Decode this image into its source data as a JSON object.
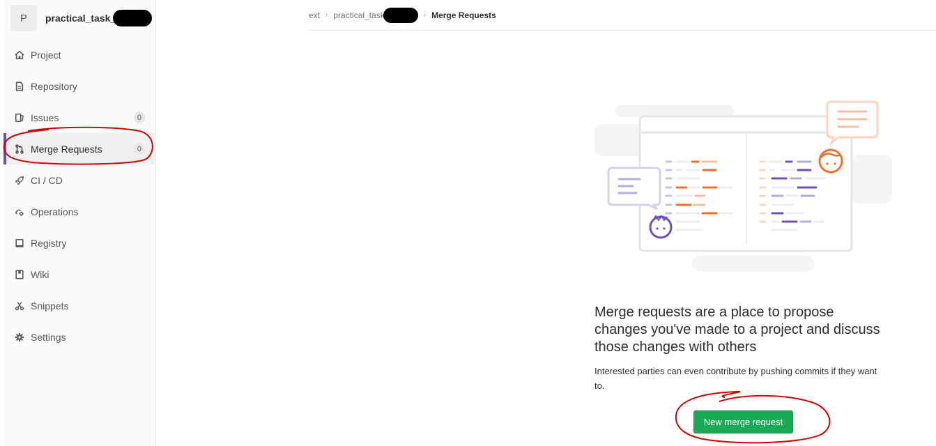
{
  "sidebar": {
    "project_avatar_letter": "P",
    "project_name": "practical_task_",
    "items": [
      {
        "label": "Project",
        "icon": "home-icon",
        "count": null
      },
      {
        "label": "Repository",
        "icon": "document-icon",
        "count": null
      },
      {
        "label": "Issues",
        "icon": "issues-icon",
        "count": "0"
      },
      {
        "label": "Merge Requests",
        "icon": "merge-request-icon",
        "count": "0",
        "active": true
      },
      {
        "label": "CI / CD",
        "icon": "rocket-icon",
        "count": null
      },
      {
        "label": "Operations",
        "icon": "cloud-gear-icon",
        "count": null
      },
      {
        "label": "Registry",
        "icon": "disk-icon",
        "count": null
      },
      {
        "label": "Wiki",
        "icon": "book-icon",
        "count": null
      },
      {
        "label": "Snippets",
        "icon": "scissors-icon",
        "count": null
      },
      {
        "label": "Settings",
        "icon": "gear-icon",
        "count": null
      }
    ]
  },
  "breadcrumb": {
    "items": [
      "ext",
      "practical_task",
      "Merge Requests"
    ]
  },
  "empty_state": {
    "title": "Merge requests are a place to propose changes you've made to a project and discuss those changes with others",
    "description": "Interested parties can even contribute by pushing commits if they want to.",
    "button_label": "New merge request"
  },
  "colors": {
    "accent": "#6b4fbb",
    "button_green": "#1aaa55",
    "annotation_red": "#d40000",
    "illustration_orange": "#fc6d26",
    "illustration_purple": "#6b4fbb"
  }
}
